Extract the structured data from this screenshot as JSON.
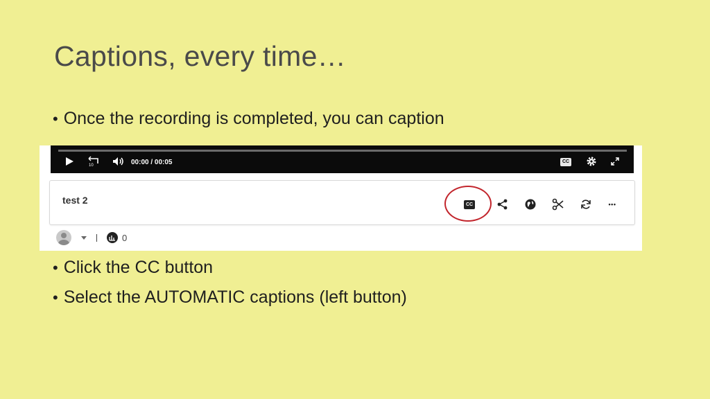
{
  "slide": {
    "title": "Captions, every time…",
    "bullets": [
      "Once the recording is completed, you can caption",
      "Click the CC button",
      "Select the AUTOMATIC captions (left button)"
    ]
  },
  "player": {
    "current_time": "00:00",
    "separator": "/",
    "duration": "00:05",
    "rewind_label": "10",
    "cc_label": "CC",
    "icons": [
      "play-icon",
      "rewind-10-icon",
      "volume-icon",
      "cc-icon",
      "settings-gear-icon",
      "fullscreen-icon"
    ]
  },
  "video": {
    "title": "test 2",
    "actions": [
      "cc-icon",
      "share-icon",
      "globe-icon",
      "scissors-icon",
      "refresh-icon",
      "more-icon"
    ],
    "cc_label": "CC",
    "more_label": "•••",
    "views_count": "0"
  },
  "colors": {
    "background": "#f0ef93",
    "highlight_circle": "#c2252c",
    "player_bar": "#0b0b0b"
  }
}
